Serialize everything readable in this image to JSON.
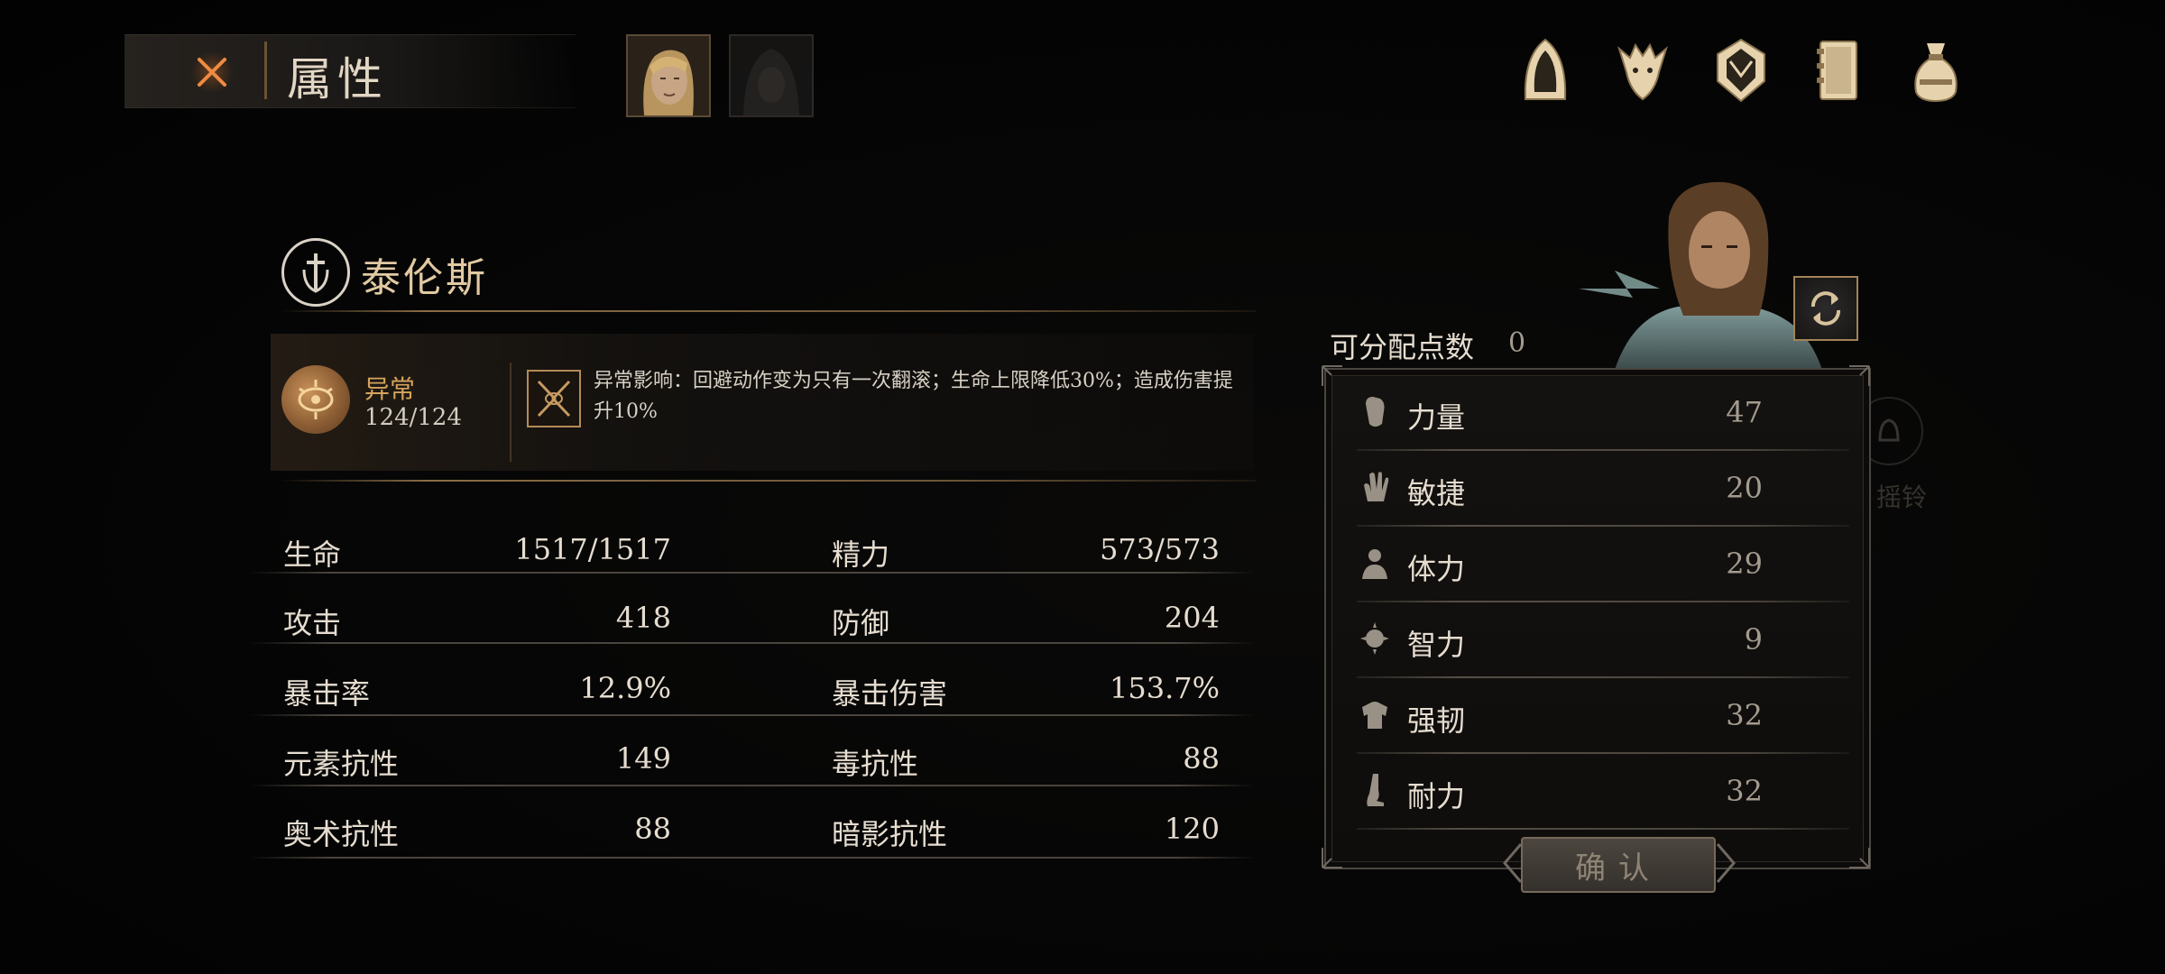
{
  "header": {
    "title": "属性"
  },
  "character": {
    "name": "泰伦斯",
    "status": {
      "name": "异常",
      "value": "124/124",
      "effect": "异常影响：回避动作变为只有一次翻滚；生命上限降低30%；造成伤害提升10%"
    }
  },
  "stats": [
    {
      "label": "生命",
      "value": "1517/1517"
    },
    {
      "label": "精力",
      "value": "573/573"
    },
    {
      "label": "攻击",
      "value": "418"
    },
    {
      "label": "防御",
      "value": "204"
    },
    {
      "label": "暴击率",
      "value": "12.9%"
    },
    {
      "label": "暴击伤害",
      "value": "153.7%"
    },
    {
      "label": "元素抗性",
      "value": "149"
    },
    {
      "label": "毒抗性",
      "value": "88"
    },
    {
      "label": "奥术抗性",
      "value": "88"
    },
    {
      "label": "暗影抗性",
      "value": "120"
    }
  ],
  "allocation": {
    "points_label": "可分配点数",
    "points_value": "0",
    "attributes": [
      {
        "label": "力量",
        "value": "47",
        "icon": "fist-icon"
      },
      {
        "label": "敏捷",
        "value": "20",
        "icon": "hand-icon"
      },
      {
        "label": "体力",
        "value": "29",
        "icon": "body-icon"
      },
      {
        "label": "智力",
        "value": "9",
        "icon": "mind-icon"
      },
      {
        "label": "强韧",
        "value": "32",
        "icon": "armor-icon"
      },
      {
        "label": "耐力",
        "value": "32",
        "icon": "leg-icon"
      }
    ],
    "confirm_label": "确认"
  },
  "background": {
    "ghost_label": "摇铃"
  },
  "top_icons": [
    "hood-icon",
    "beast-icon",
    "crest-icon",
    "journal-icon",
    "bag-icon"
  ],
  "colors": {
    "accent_gold": "#d6a35c",
    "name_gold": "#e1c9a2",
    "close_orange": "#e5773a"
  }
}
